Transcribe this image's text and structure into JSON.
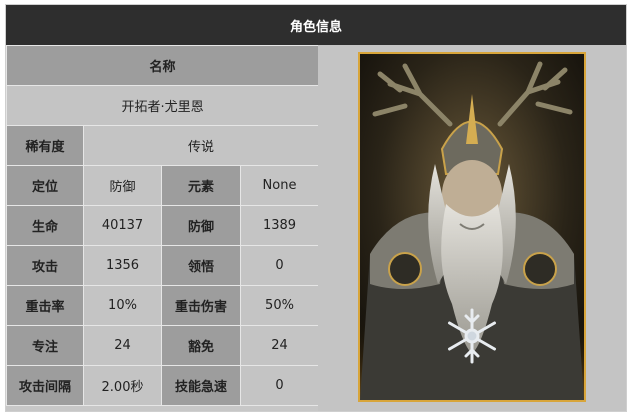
{
  "header": {
    "title": "角色信息"
  },
  "name": {
    "label": "名称",
    "value": "开拓者·尤里恩"
  },
  "rarity": {
    "label": "稀有度",
    "value": "传说"
  },
  "stats": {
    "position": {
      "label": "定位",
      "value": "防御"
    },
    "element": {
      "label": "元素",
      "value": "None"
    },
    "hp": {
      "label": "生命",
      "value": "40137"
    },
    "defense": {
      "label": "防御",
      "value": "1389"
    },
    "attack": {
      "label": "攻击",
      "value": "1356"
    },
    "comprehension": {
      "label": "领悟",
      "value": "0"
    },
    "crit_rate": {
      "label": "重击率",
      "value": "10%"
    },
    "crit_damage": {
      "label": "重击伤害",
      "value": "50%"
    },
    "focus": {
      "label": "专注",
      "value": "24"
    },
    "immunity": {
      "label": "豁免",
      "value": "24"
    },
    "attack_interval": {
      "label": "攻击间隔",
      "value": "2.00秒"
    },
    "skill_haste": {
      "label": "技能急速",
      "value": "0"
    }
  },
  "portrait": {
    "icon": "character-portrait",
    "border_color": "#d8a53a",
    "emblem": "snowflake-emblem-icon"
  }
}
